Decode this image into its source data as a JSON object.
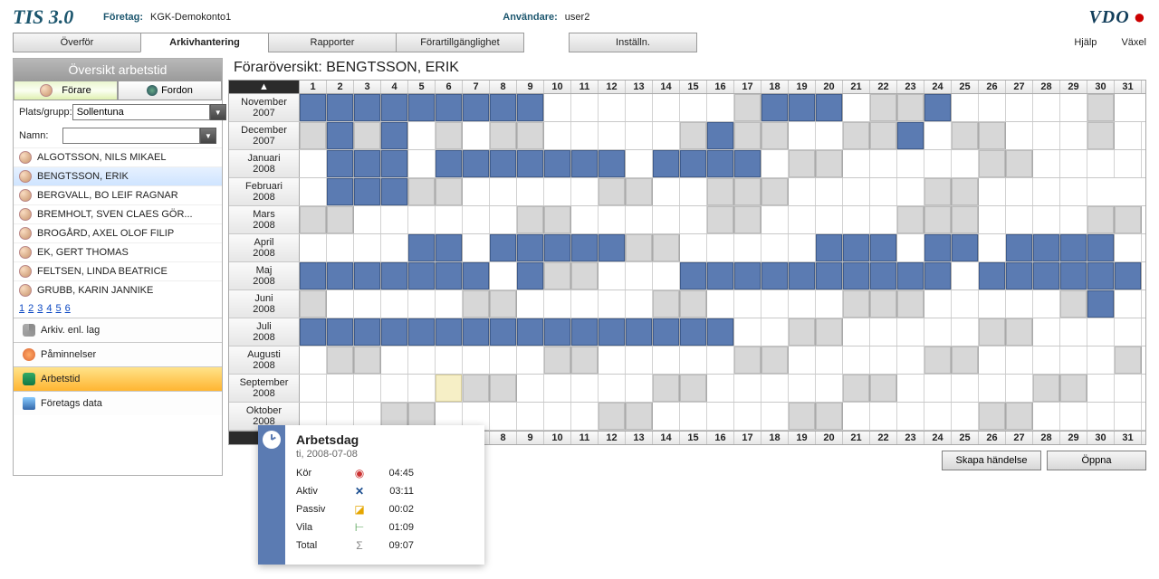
{
  "header": {
    "app_title": "TIS 3.0",
    "company_label": "Företag:",
    "company_value": "KGK-Demokonto1",
    "user_label": "Användare:",
    "user_value": "user2",
    "brand": "VDO"
  },
  "tabs": {
    "t1": "Överför",
    "t2": "Arkivhantering",
    "t3": "Rapporter",
    "t4": "Förartillgänglighet",
    "t5": "Inställn."
  },
  "links": {
    "help": "Hjälp",
    "switch": "Växel"
  },
  "sidebar": {
    "title": "Översikt arbetstid",
    "btn_drivers": "Förare",
    "btn_vehicles": "Fordon",
    "place_label": "Plats/grupp:",
    "place_value": "Sollentuna",
    "name_label": "Namn:",
    "name_value": "",
    "drivers": [
      "ALGOTSSON, NILS MIKAEL",
      "BENGTSSON, ERIK",
      "BERGVALL, BO LEIF RAGNAR",
      "BREMHOLT, SVEN CLAES GÖR...",
      "BROGÅRD, AXEL OLOF FILIP",
      "EK, GERT THOMAS",
      "FELTSEN, LINDA BEATRICE",
      "GRUBB, KARIN JANNIKE"
    ],
    "pages": [
      "1",
      "2",
      "3",
      "4",
      "5",
      "6"
    ],
    "actions": {
      "arkiv": "Arkiv. enl. lag",
      "paminn": "Påminnelser",
      "arbetstid": "Arbetstid",
      "foretag": "Företags data"
    }
  },
  "content": {
    "title_prefix": "Föraröversikt: ",
    "title_name": "BENGTSSON, ERIK",
    "days": [
      "1",
      "2",
      "3",
      "4",
      "5",
      "6",
      "7",
      "8",
      "9",
      "10",
      "11",
      "12",
      "13",
      "14",
      "15",
      "16",
      "17",
      "18",
      "19",
      "20",
      "21",
      "22",
      "23",
      "24",
      "25",
      "26",
      "27",
      "28",
      "29",
      "30",
      "31"
    ],
    "months": [
      {
        "name": "November",
        "year": "2007",
        "cells": "bbbbbbbbb.......gbbb.ggb.....g"
      },
      {
        "name": "December",
        "year": "2007",
        "cells": "gbgb.g.gg.....gbgg..ggb.gg...g."
      },
      {
        "name": "Januari",
        "year": "2008",
        "cells": ".bbb.bbbbbbb.bbbb.gg.....gg...."
      },
      {
        "name": "Februari",
        "year": "2008",
        "cells": ".bbbgg.....gg..ggg.....gg....  "
      },
      {
        "name": "Mars",
        "year": "2008",
        "cells": "gg......gg.....gg.....ggg....gg"
      },
      {
        "name": "April",
        "year": "2008",
        "cells": "....bb.bbbbbgg.....bbb.bb.bbbb."
      },
      {
        "name": "Maj",
        "year": "2008",
        "cells": "bbbbbbb.bgg...bbbbbbbbbb.bbbbbb"
      },
      {
        "name": "Juni",
        "year": "2008",
        "cells": "g.....gg.....gg.....ggg.....gb."
      },
      {
        "name": "Juli",
        "year": "2008",
        "cells": "bbbbbbbbbbbbbbbb..gg.....gg...."
      },
      {
        "name": "Augusti",
        "year": "2008",
        "cells": ".gg......gg.....gg.....gg.....g"
      },
      {
        "name": "September",
        "year": "2008",
        "cells": ".....ygg.....gg.....gg.....gg.."
      },
      {
        "name": "Oktober",
        "year": "2008",
        "cells": "...gg......gg.....gg.....gg...."
      }
    ],
    "btn_create": "Skapa händelse",
    "btn_open": "Öppna"
  },
  "tooltip": {
    "title": "Arbetsdag",
    "date": "ti, 2008-07-08",
    "rows": [
      {
        "label": "Kör",
        "icon": "◉",
        "cls": "ic-kor",
        "value": "04:45"
      },
      {
        "label": "Aktiv",
        "icon": "✕",
        "cls": "ic-aktiv",
        "value": "03:11"
      },
      {
        "label": "Passiv",
        "icon": "◪",
        "cls": "ic-passiv",
        "value": "00:02"
      },
      {
        "label": "Vila",
        "icon": "⊢",
        "cls": "ic-vila",
        "value": "01:09"
      },
      {
        "label": "Total",
        "icon": "Σ",
        "cls": "ic-total",
        "value": "09:07"
      }
    ]
  }
}
